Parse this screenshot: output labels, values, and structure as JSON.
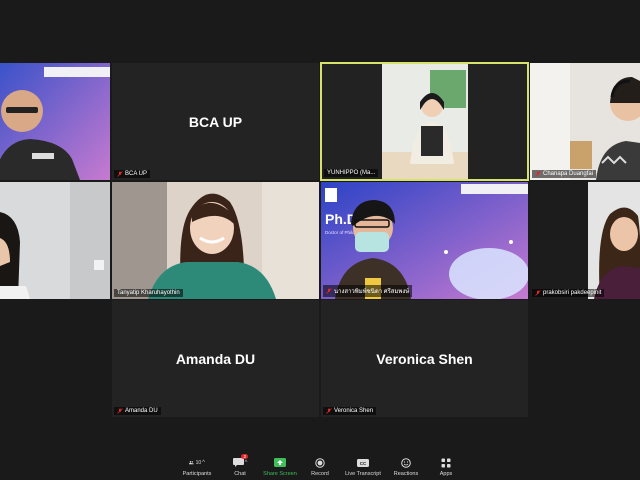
{
  "tiles": [
    {
      "id": "t1",
      "name": "",
      "muted": false
    },
    {
      "id": "t2",
      "name": "BCA UP",
      "display": "BCA UP",
      "muted": true
    },
    {
      "id": "t3",
      "name": "YUNHIPPO (Ma...",
      "muted": false
    },
    {
      "id": "t4",
      "name": "Chanapa Duangfai",
      "muted": true
    },
    {
      "id": "t5",
      "name": "",
      "muted": false
    },
    {
      "id": "t6",
      "name": "Tanyatip Kharuhayothin",
      "muted": false
    },
    {
      "id": "t7",
      "name": "นางสาวพิมพ์ชนิดา ศรีสมพงษ์",
      "muted": true
    },
    {
      "id": "t8",
      "name": "prakobsiri pakdeepinit",
      "muted": true
    },
    {
      "id": "t9",
      "name": "Amanda DU",
      "display": "Amanda DU",
      "muted": true
    },
    {
      "id": "t10",
      "name": "Veronica Shen",
      "display": "Veronica Shen",
      "muted": true
    }
  ],
  "slide": {
    "title": "Ph.D",
    "caption": "Doctor of Philosophy"
  },
  "toolbar": {
    "participants_label": "Participants",
    "participants_count": "10",
    "chat_label": "Chat",
    "chat_badge": "2",
    "share_label": "Share Screen",
    "record_label": "Record",
    "transcript_label": "Live Transcript",
    "reactions_label": "Reactions",
    "apps_label": "Apps"
  },
  "colors": {
    "active_speaker": "#d6e36a",
    "share_green": "#3fbf5a",
    "muted_red": "#e02828"
  }
}
